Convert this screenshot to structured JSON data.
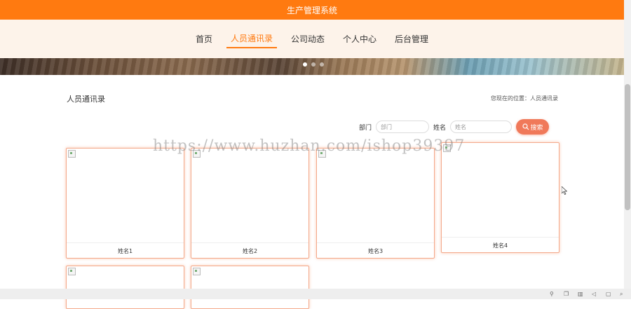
{
  "header": {
    "title": "生产管理系统"
  },
  "nav": {
    "items": [
      {
        "label": "首页",
        "active": false
      },
      {
        "label": "人员通讯录",
        "active": true
      },
      {
        "label": "公司动态",
        "active": false
      },
      {
        "label": "个人中心",
        "active": false
      },
      {
        "label": "后台管理",
        "active": false
      }
    ]
  },
  "carousel": {
    "dots": 3,
    "active_dot": 1
  },
  "page": {
    "title": "人员通讯录",
    "breadcrumb": "您现在的位置：人员通讯录"
  },
  "search": {
    "dept_label": "部门",
    "dept_placeholder": "部门",
    "name_label": "姓名",
    "name_placeholder": "姓名",
    "button_label": "搜索"
  },
  "cards": [
    {
      "name": "姓名1"
    },
    {
      "name": "姓名2"
    },
    {
      "name": "姓名3"
    },
    {
      "name": "姓名4"
    },
    {
      "name": ""
    },
    {
      "name": ""
    }
  ],
  "watermark": "https://www.huzhan.com/ishop39397",
  "colors": {
    "accent": "#ff7a10",
    "button": "#f0795a",
    "card_border": "#f4a98b"
  }
}
